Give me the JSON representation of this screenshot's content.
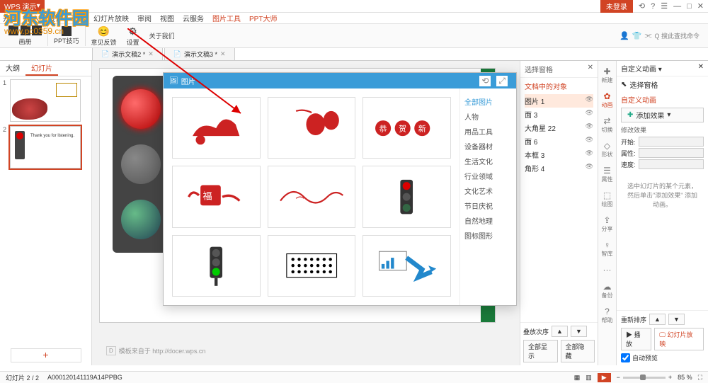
{
  "titlebar": {
    "app": "WPS 演示",
    "login": "未登录",
    "icons": [
      "⟲",
      "?",
      "☰",
      "—",
      "□",
      "✕"
    ]
  },
  "menu": [
    "开始",
    "插入",
    "设计",
    "动画",
    "幻灯片放映",
    "审阅",
    "视图",
    "云服务",
    "图片工具",
    "PPT大师"
  ],
  "menu_active_idx": [
    8,
    9
  ],
  "ribbon": {
    "items": [
      "画册",
      "PPT技巧",
      "意见反馈",
      "设置",
      "关于我们"
    ]
  },
  "doctabs": [
    {
      "label": "演示文稿2 *"
    },
    {
      "label": "演示文稿3 *"
    }
  ],
  "left_tabs": [
    "大纲",
    "幻灯片"
  ],
  "left_tab_active": 1,
  "slide_footer": "模板来自于 http://docer.wps.cn",
  "dialog": {
    "title": "图片",
    "categories": [
      "全部图片",
      "人物",
      "用品工具",
      "设备器材",
      "生活文化",
      "行业领域",
      "文化艺术",
      "节日庆祝",
      "自然地理",
      "图标图形"
    ],
    "cat_active": 0
  },
  "selection_pane": {
    "header": "选择窗格",
    "section": "文档中的对象",
    "items": [
      {
        "label": "图片 1",
        "active": true
      },
      {
        "label": "面 3"
      },
      {
        "label": "大角星 22"
      },
      {
        "label": "面 6"
      },
      {
        "label": "本框 3"
      },
      {
        "label": "角形 4"
      }
    ],
    "order_label": "叠放次序",
    "show_all": "全部显示",
    "hide_all": "全部隐藏"
  },
  "tool_strip": [
    {
      "ico": "✚",
      "label": "新建"
    },
    {
      "ico": "✿",
      "label": "动画",
      "active": true
    },
    {
      "ico": "⇄",
      "label": "切换"
    },
    {
      "ico": "◇",
      "label": "形状"
    },
    {
      "ico": "☰",
      "label": "属性"
    },
    {
      "ico": "⬚",
      "label": "绘图"
    },
    {
      "ico": "⇪",
      "label": "分享"
    },
    {
      "ico": "♀",
      "label": "智库"
    },
    {
      "ico": "···",
      "label": ""
    },
    {
      "ico": "☁",
      "label": "备份"
    },
    {
      "ico": "?",
      "label": "帮助"
    }
  ],
  "anim_pane": {
    "header": "自定义动画 ▾",
    "sel_icon_label": "选择窗格",
    "title": "自定义动画",
    "add_effect": "添加效果",
    "modify": "修改效果",
    "row1": "开始:",
    "row2": "属性:",
    "row3": "速度:",
    "msg": "选中幻灯片的某个元素，然后单击\"添加效果\" 添加动画。",
    "reorder": "重新排序",
    "play": "播放",
    "slideshow": "幻灯片放映",
    "autopreview": "自动预览"
  },
  "header_search": {
    "placeholder": "Q 搜此查找命令"
  },
  "status": {
    "slide": "幻灯片 2 / 2",
    "doc": "A000120141119A14PPBG",
    "zoom": "85 %"
  },
  "watermark": {
    "text": "河东软件园",
    "url": "www.pc0359.cn"
  }
}
